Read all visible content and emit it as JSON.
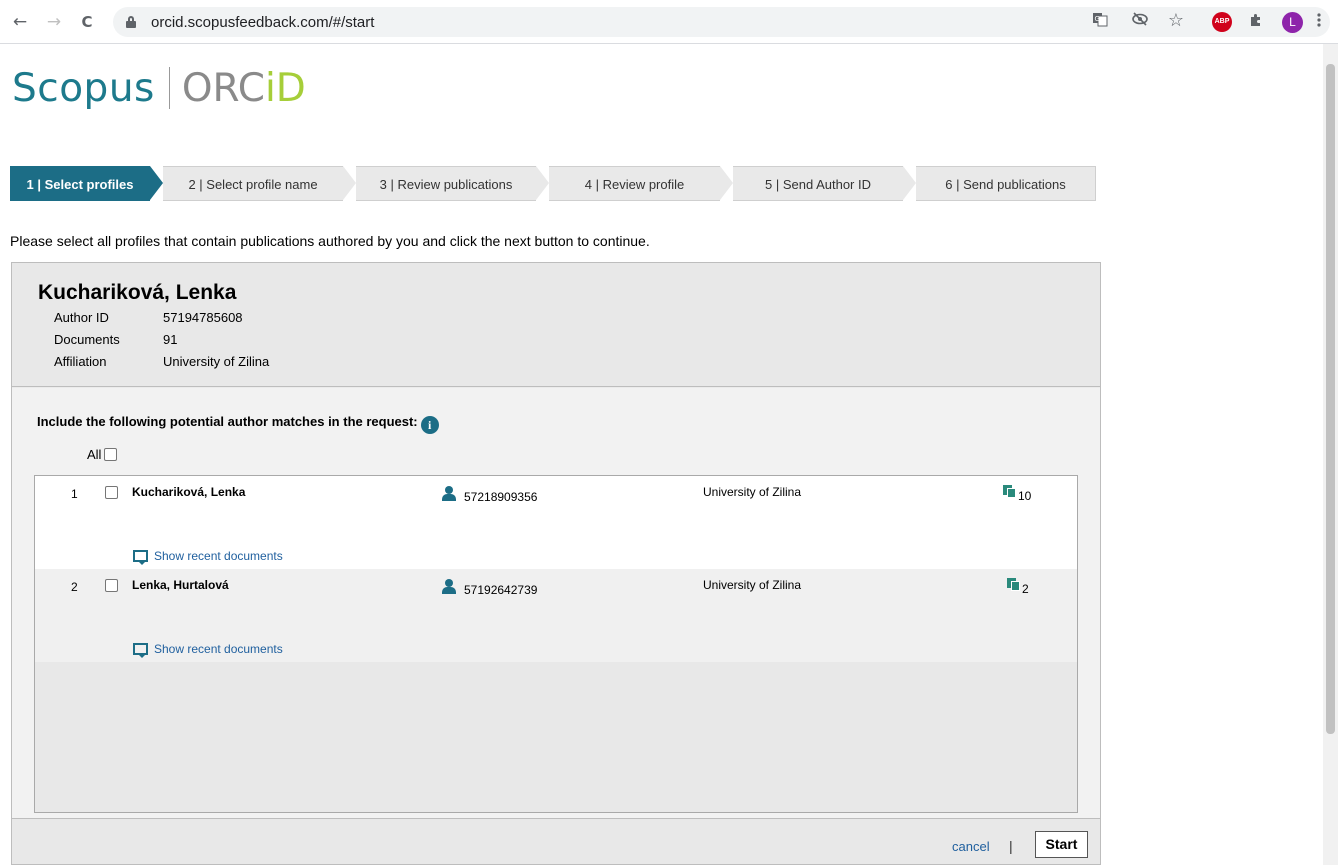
{
  "browser": {
    "url": "orcid.scopusfeedback.com/#/start",
    "back_icon": "←",
    "forward_icon": "→",
    "reload_icon": "C",
    "abp_label": "ABP",
    "profile_initial": "L"
  },
  "logo": {
    "scopus": "Scopus",
    "orc": "ORC",
    "id": "iD"
  },
  "steps": [
    {
      "num": "1",
      "label": "Select profiles",
      "active": true
    },
    {
      "num": "2",
      "label": "Select profile name"
    },
    {
      "num": "3",
      "label": "Review publications"
    },
    {
      "num": "4",
      "label": "Review profile"
    },
    {
      "num": "5",
      "label": "Send Author ID"
    },
    {
      "num": "6",
      "label": "Send publications"
    }
  ],
  "instruction": "Please select all profiles that contain publications authored by you and click the next button to continue.",
  "profile": {
    "name": "Kuchariková, Lenka",
    "author_id_label": "Author ID",
    "author_id": "57194785608",
    "documents_label": "Documents",
    "documents": "91",
    "affiliation_label": "Affiliation",
    "affiliation": "University of Zilina"
  },
  "matches": {
    "heading": "Include the following potential author matches in the request:",
    "info_icon": "i",
    "all_label": "All",
    "rows": [
      {
        "num": "1",
        "name": "Kuchariková, Lenka",
        "id": "57218909356",
        "affiliation": "University of Zilina",
        "docs": "10",
        "show_recent": "Show recent documents"
      },
      {
        "num": "2",
        "name": "Lenka, Hurtalová",
        "id": "57192642739",
        "affiliation": "University of Zilina",
        "docs": "2",
        "show_recent": "Show recent documents"
      }
    ]
  },
  "footer": {
    "cancel": "cancel",
    "separator": "|",
    "start": "Start"
  }
}
